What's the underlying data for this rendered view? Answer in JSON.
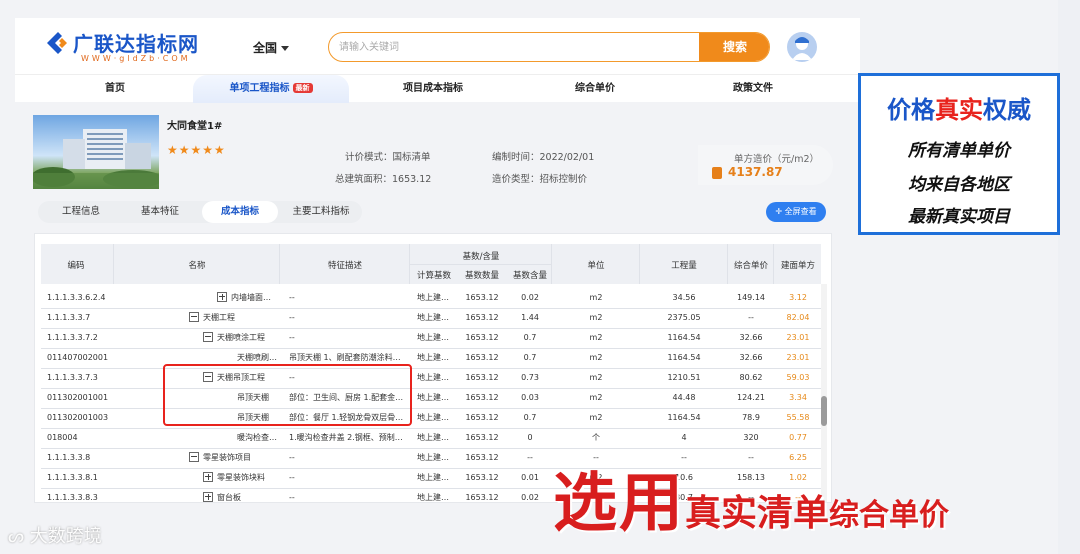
{
  "header": {
    "logo_text": "广联达指标网",
    "logo_sub": "WWW·gldZb·COM",
    "region": "全国",
    "search_placeholder": "请输入关键词",
    "search_button": "搜索"
  },
  "nav": {
    "items": [
      "首页",
      "单项工程指标",
      "项目成本指标",
      "综合单价",
      "政策文件"
    ],
    "new_badge": "最新"
  },
  "project": {
    "title": "大同食堂1#",
    "stars": "★★★★★",
    "pricing_mode": "计价模式：国标清单",
    "total_area": "总建筑面积：1653.12",
    "compile_time": "编制时间：2022/02/01",
    "cost_type": "造价类型：招标控制价",
    "unit_cost_label": "单方造价（元/m2）",
    "unit_cost_value": "4137.87"
  },
  "tabs": {
    "items": [
      "工程信息",
      "基本特征",
      "成本指标",
      "主要工料指标"
    ],
    "view_all": "全屏查看"
  },
  "table": {
    "headers": {
      "code": "编码",
      "name": "名称",
      "feature": "特征描述",
      "base_group": "基数/含量",
      "calc_base": "计算基数",
      "base_qty": "基数数量",
      "base_content": "基数含量",
      "unit": "单位",
      "quantity": "工程量",
      "unit_price": "综合单价",
      "area_price": "建面单方"
    },
    "rows": [
      {
        "code": "1.1.1.3.3.6.2.4",
        "name": "内墙墙面…",
        "feature": "--",
        "calc_base": "地上建…",
        "base_qty": "1653.12",
        "base_content": "0.02",
        "unit": "m2",
        "quantity": "34.56",
        "unit_price": "149.14",
        "area_price": "3.12"
      },
      {
        "code": "1.1.1.3.3.7",
        "name": "天棚工程",
        "feature": "--",
        "calc_base": "地上建…",
        "base_qty": "1653.12",
        "base_content": "1.44",
        "unit": "m2",
        "quantity": "2375.05",
        "unit_price": "--",
        "area_price": "82.04"
      },
      {
        "code": "1.1.1.3.3.7.2",
        "name": "天棚喷涂工程",
        "feature": "--",
        "calc_base": "地上建…",
        "base_qty": "1653.12",
        "base_content": "0.7",
        "unit": "m2",
        "quantity": "1164.54",
        "unit_price": "32.66",
        "area_price": "23.01"
      },
      {
        "code": "011407002001",
        "name": "天棚喷刷…",
        "feature": "吊顶天棚 1、刷配套防潮涂料…",
        "calc_base": "地上建…",
        "base_qty": "1653.12",
        "base_content": "0.7",
        "unit": "m2",
        "quantity": "1164.54",
        "unit_price": "32.66",
        "area_price": "23.01"
      },
      {
        "code": "1.1.1.3.3.7.3",
        "name": "天棚吊顶工程",
        "feature": "--",
        "calc_base": "地上建…",
        "base_qty": "1653.12",
        "base_content": "0.73",
        "unit": "m2",
        "quantity": "1210.51",
        "unit_price": "80.62",
        "area_price": "59.03"
      },
      {
        "code": "011302001001",
        "name": "吊顶天棚",
        "feature": "部位：卫生间、厨房 1.配套金…",
        "calc_base": "地上建…",
        "base_qty": "1653.12",
        "base_content": "0.03",
        "unit": "m2",
        "quantity": "44.48",
        "unit_price": "124.21",
        "area_price": "3.34"
      },
      {
        "code": "011302001003",
        "name": "吊顶天棚",
        "feature": "部位：餐厅 1.轻钢龙骨双层骨…",
        "calc_base": "地上建…",
        "base_qty": "1653.12",
        "base_content": "0.7",
        "unit": "m2",
        "quantity": "1164.54",
        "unit_price": "78.9",
        "area_price": "55.58"
      },
      {
        "code": "018004",
        "name": "暖沟检查…",
        "feature": "1.暖沟检查井盖 2.钢框、预制…",
        "calc_base": "地上建…",
        "base_qty": "1653.12",
        "base_content": "0",
        "unit": "个",
        "quantity": "4",
        "unit_price": "320",
        "area_price": "0.77"
      },
      {
        "code": "1.1.1.3.3.8",
        "name": "零星装饰项目",
        "feature": "--",
        "calc_base": "地上建…",
        "base_qty": "1653.12",
        "base_content": "--",
        "unit": "--",
        "quantity": "--",
        "unit_price": "--",
        "area_price": "6.25"
      },
      {
        "code": "1.1.1.3.3.8.1",
        "name": "零星装饰块料",
        "feature": "--",
        "calc_base": "地上建…",
        "base_qty": "1653.12",
        "base_content": "0.01",
        "unit": "m2",
        "quantity": "10.6",
        "unit_price": "158.13",
        "area_price": "1.02"
      },
      {
        "code": "1.1.1.3.3.8.3",
        "name": "窗台板",
        "feature": "--",
        "calc_base": "地上建…",
        "base_qty": "1653.12",
        "base_content": "0.02",
        "unit": "m2",
        "quantity": "30.7",
        "unit_price": "--",
        "area_price": "--"
      }
    ]
  },
  "ad": {
    "title_a": "价格",
    "title_b": "真实",
    "title_c": "权威",
    "line1": "所有清单单价",
    "line2": "均来自各地区",
    "line3": "最新真实项目"
  },
  "caption": {
    "part1": "选用",
    "part2": "真实清单",
    "part3": "综合单价"
  },
  "watermark": "大数跨境",
  "colors": {
    "brand_blue": "#1a56c8",
    "accent_orange": "#f08a1b",
    "highlight_red": "#e8231d"
  }
}
